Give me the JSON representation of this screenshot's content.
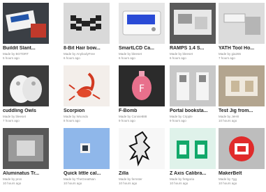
{
  "items": [
    {
      "title": "Buildit Slant...",
      "made_by": "Made by BOTDRT",
      "time": "5 hours ago",
      "icon": "printer-board-thumbnail"
    },
    {
      "title": "8-Bit Hair bow...",
      "made_by": "Made by AnybodyFree",
      "time": "6 hours ago",
      "icon": "pixel-bow-thumbnail"
    },
    {
      "title": "SmartLCD Ca...",
      "made_by": "Made by bleeset",
      "time": "6 hours ago",
      "icon": "lcd-case-thumbnail"
    },
    {
      "title": "RAMPS 1.4 S...",
      "made_by": "Made by bleeset",
      "time": "6 hours ago",
      "icon": "electronics-board-thumbnail"
    },
    {
      "title": "YATH Tool Ho...",
      "made_by": "Made by gia265",
      "time": "7 hours ago",
      "icon": "tool-holder-thumbnail"
    },
    {
      "title": "cuddling Owls",
      "made_by": "Made by bleeset",
      "time": "7 hours ago",
      "icon": "owls-thumbnail"
    },
    {
      "title": "Scorpion",
      "made_by": "Made by Woondo",
      "time": "8 hours ago",
      "icon": "scorpion-thumbnail"
    },
    {
      "title": "F-Bomb",
      "made_by": "Made by Connie888",
      "time": "9 hours ago",
      "icon": "bomb-thumbnail"
    },
    {
      "title": "Portal booksta...",
      "made_by": "Made by Cripple",
      "time": "9 hours ago",
      "icon": "bookstand-thumbnail"
    },
    {
      "title": "Test Jig from...",
      "made_by": "Made by JeH8",
      "time": "10 hours ago",
      "icon": "test-jig-thumbnail"
    },
    {
      "title": "Aluminatus Tr...",
      "made_by": "Made by pros",
      "time": "10 hours ago",
      "icon": "aluminum-part-thumbnail"
    },
    {
      "title": "Quick little cal...",
      "made_by": "Made by TheGreatNan",
      "time": "10 hours ago",
      "icon": "calibration-cube-thumbnail"
    },
    {
      "title": "Zilla",
      "made_by": "Made by fernster",
      "time": "10 hours ago",
      "icon": "dinosaur-thumbnail"
    },
    {
      "title": "Z Axis Calibra...",
      "made_by": "Made by fretgoria",
      "time": "10 hours ago",
      "icon": "z-axis-thumbnail"
    },
    {
      "title": "MakerBelt",
      "made_by": "Made by 7gg",
      "time": "10 hours ago",
      "icon": "makerbot-logo-thumbnail"
    }
  ]
}
